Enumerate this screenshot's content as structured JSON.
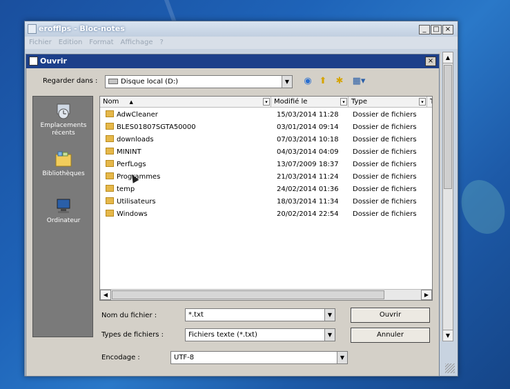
{
  "notepad": {
    "title": "erofflps - Bloc-notes",
    "menu": [
      "Fichier",
      "Edition",
      "Format",
      "Affichage",
      "?"
    ],
    "controls": [
      "_",
      "□",
      "×"
    ]
  },
  "dialog": {
    "title": "Ouvrir",
    "close": "×",
    "look_in_label": "Regarder dans :",
    "look_in_value": "Disque local (D:)",
    "places": [
      {
        "label": "Emplacements récents",
        "icon": "recent-places-icon"
      },
      {
        "label": "Bibliothèques",
        "icon": "libraries-icon"
      },
      {
        "label": "Ordinateur",
        "icon": "computer-icon"
      }
    ],
    "columns": {
      "name": "Nom",
      "modified": "Modifié le",
      "type": "Type",
      "extra": "T"
    },
    "files": [
      {
        "name": "AdwCleaner",
        "modified": "15/03/2014 11:28",
        "type": "Dossier de fichiers"
      },
      {
        "name": "BLES01807SGTA50000",
        "modified": "03/01/2014 09:14",
        "type": "Dossier de fichiers"
      },
      {
        "name": "downloads",
        "modified": "07/03/2014 10:18",
        "type": "Dossier de fichiers"
      },
      {
        "name": "MININT",
        "modified": "04/03/2014 04:09",
        "type": "Dossier de fichiers"
      },
      {
        "name": "PerfLogs",
        "modified": "13/07/2009 18:37",
        "type": "Dossier de fichiers"
      },
      {
        "name": "Programmes",
        "modified": "21/03/2014 11:24",
        "type": "Dossier de fichiers"
      },
      {
        "name": "temp",
        "modified": "24/02/2014 01:36",
        "type": "Dossier de fichiers"
      },
      {
        "name": "Utilisateurs",
        "modified": "18/03/2014 11:34",
        "type": "Dossier de fichiers"
      },
      {
        "name": "Windows",
        "modified": "20/02/2014 22:54",
        "type": "Dossier de fichiers"
      }
    ],
    "filename_label": "Nom du fichier :",
    "filename_value": "*.txt",
    "filetype_label": "Types de fichiers :",
    "filetype_value": "Fichiers texte (*.txt)",
    "encoding_label": "Encodage :",
    "encoding_value": "UTF-8",
    "open_button": "Ouvrir",
    "cancel_button": "Annuler"
  }
}
